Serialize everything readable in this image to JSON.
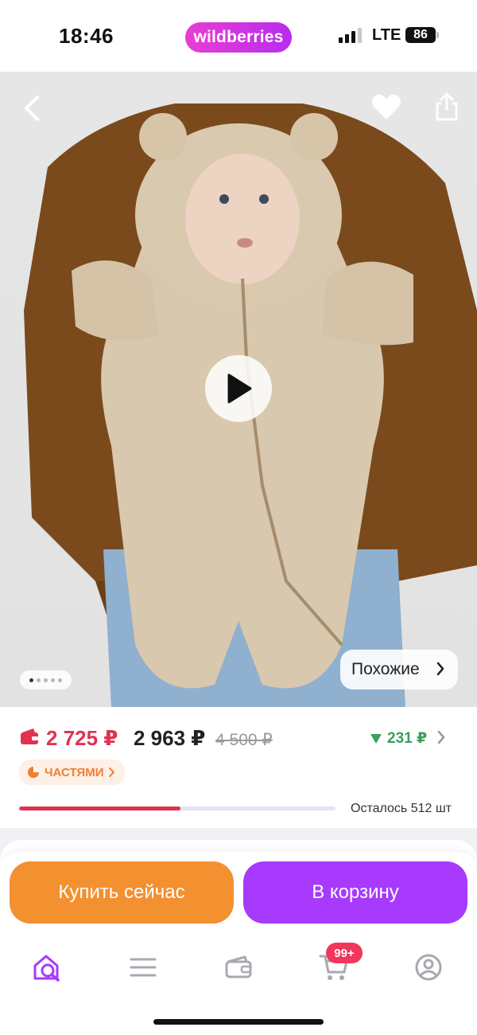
{
  "status_bar": {
    "time": "18:46",
    "brand": "wildberries",
    "network": "LTE",
    "battery": "86"
  },
  "hero": {
    "icons": {
      "back": "chevron-left-icon",
      "favorite": "heart-icon",
      "share": "share-icon",
      "play": "play-icon"
    },
    "gallery": {
      "total_images": 5,
      "current_index": 1
    },
    "similar_label": "Похожие"
  },
  "pricing": {
    "wallet_price": "2 725 ₽",
    "current_price": "2 963 ₽",
    "old_price": "4 500 ₽",
    "difference": "231 ₽",
    "installments_label": "ЧАСТЯМИ",
    "stock_fraction": 0.51,
    "stock_text": "Осталось 512 шт",
    "colors": {
      "wallet_price": "#e0334f",
      "difference": "#3aa05b",
      "installments": "#f08030"
    }
  },
  "actions": {
    "buy_now": "Купить сейчас",
    "add_to_cart": "В корзину",
    "colors": {
      "buy_now": "#f39030",
      "add_to_cart": "#a73afd"
    }
  },
  "tabbar": {
    "items": [
      {
        "name": "home",
        "icon": "home-search-icon",
        "active": true
      },
      {
        "name": "catalog",
        "icon": "menu-icon",
        "active": false
      },
      {
        "name": "wallet",
        "icon": "wallet-icon",
        "active": false
      },
      {
        "name": "cart",
        "icon": "cart-icon",
        "active": false
      },
      {
        "name": "profile",
        "icon": "profile-icon",
        "active": false
      }
    ],
    "cart_badge": "99+",
    "accent": "#a73afd"
  }
}
